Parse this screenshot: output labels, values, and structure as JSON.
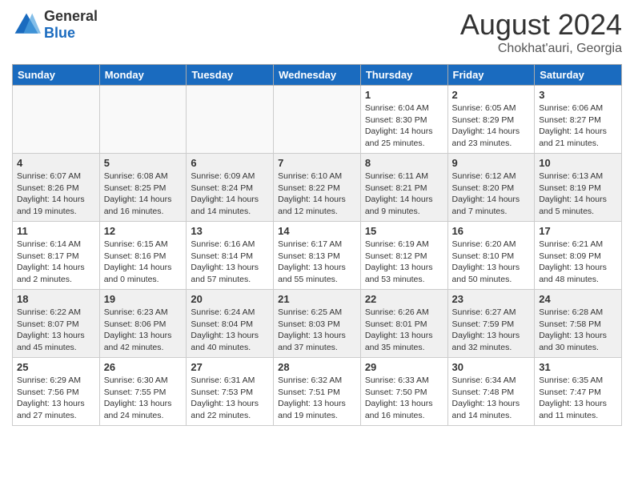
{
  "header": {
    "logo_general": "General",
    "logo_blue": "Blue",
    "month_title": "August 2024",
    "location": "Chokhat'auri, Georgia"
  },
  "days_of_week": [
    "Sunday",
    "Monday",
    "Tuesday",
    "Wednesday",
    "Thursday",
    "Friday",
    "Saturday"
  ],
  "weeks": [
    [
      {
        "day": "",
        "info": ""
      },
      {
        "day": "",
        "info": ""
      },
      {
        "day": "",
        "info": ""
      },
      {
        "day": "",
        "info": ""
      },
      {
        "day": "1",
        "info": "Sunrise: 6:04 AM\nSunset: 8:30 PM\nDaylight: 14 hours and 25 minutes."
      },
      {
        "day": "2",
        "info": "Sunrise: 6:05 AM\nSunset: 8:29 PM\nDaylight: 14 hours and 23 minutes."
      },
      {
        "day": "3",
        "info": "Sunrise: 6:06 AM\nSunset: 8:27 PM\nDaylight: 14 hours and 21 minutes."
      }
    ],
    [
      {
        "day": "4",
        "info": "Sunrise: 6:07 AM\nSunset: 8:26 PM\nDaylight: 14 hours and 19 minutes."
      },
      {
        "day": "5",
        "info": "Sunrise: 6:08 AM\nSunset: 8:25 PM\nDaylight: 14 hours and 16 minutes."
      },
      {
        "day": "6",
        "info": "Sunrise: 6:09 AM\nSunset: 8:24 PM\nDaylight: 14 hours and 14 minutes."
      },
      {
        "day": "7",
        "info": "Sunrise: 6:10 AM\nSunset: 8:22 PM\nDaylight: 14 hours and 12 minutes."
      },
      {
        "day": "8",
        "info": "Sunrise: 6:11 AM\nSunset: 8:21 PM\nDaylight: 14 hours and 9 minutes."
      },
      {
        "day": "9",
        "info": "Sunrise: 6:12 AM\nSunset: 8:20 PM\nDaylight: 14 hours and 7 minutes."
      },
      {
        "day": "10",
        "info": "Sunrise: 6:13 AM\nSunset: 8:19 PM\nDaylight: 14 hours and 5 minutes."
      }
    ],
    [
      {
        "day": "11",
        "info": "Sunrise: 6:14 AM\nSunset: 8:17 PM\nDaylight: 14 hours and 2 minutes."
      },
      {
        "day": "12",
        "info": "Sunrise: 6:15 AM\nSunset: 8:16 PM\nDaylight: 14 hours and 0 minutes."
      },
      {
        "day": "13",
        "info": "Sunrise: 6:16 AM\nSunset: 8:14 PM\nDaylight: 13 hours and 57 minutes."
      },
      {
        "day": "14",
        "info": "Sunrise: 6:17 AM\nSunset: 8:13 PM\nDaylight: 13 hours and 55 minutes."
      },
      {
        "day": "15",
        "info": "Sunrise: 6:19 AM\nSunset: 8:12 PM\nDaylight: 13 hours and 53 minutes."
      },
      {
        "day": "16",
        "info": "Sunrise: 6:20 AM\nSunset: 8:10 PM\nDaylight: 13 hours and 50 minutes."
      },
      {
        "day": "17",
        "info": "Sunrise: 6:21 AM\nSunset: 8:09 PM\nDaylight: 13 hours and 48 minutes."
      }
    ],
    [
      {
        "day": "18",
        "info": "Sunrise: 6:22 AM\nSunset: 8:07 PM\nDaylight: 13 hours and 45 minutes."
      },
      {
        "day": "19",
        "info": "Sunrise: 6:23 AM\nSunset: 8:06 PM\nDaylight: 13 hours and 42 minutes."
      },
      {
        "day": "20",
        "info": "Sunrise: 6:24 AM\nSunset: 8:04 PM\nDaylight: 13 hours and 40 minutes."
      },
      {
        "day": "21",
        "info": "Sunrise: 6:25 AM\nSunset: 8:03 PM\nDaylight: 13 hours and 37 minutes."
      },
      {
        "day": "22",
        "info": "Sunrise: 6:26 AM\nSunset: 8:01 PM\nDaylight: 13 hours and 35 minutes."
      },
      {
        "day": "23",
        "info": "Sunrise: 6:27 AM\nSunset: 7:59 PM\nDaylight: 13 hours and 32 minutes."
      },
      {
        "day": "24",
        "info": "Sunrise: 6:28 AM\nSunset: 7:58 PM\nDaylight: 13 hours and 30 minutes."
      }
    ],
    [
      {
        "day": "25",
        "info": "Sunrise: 6:29 AM\nSunset: 7:56 PM\nDaylight: 13 hours and 27 minutes."
      },
      {
        "day": "26",
        "info": "Sunrise: 6:30 AM\nSunset: 7:55 PM\nDaylight: 13 hours and 24 minutes."
      },
      {
        "day": "27",
        "info": "Sunrise: 6:31 AM\nSunset: 7:53 PM\nDaylight: 13 hours and 22 minutes."
      },
      {
        "day": "28",
        "info": "Sunrise: 6:32 AM\nSunset: 7:51 PM\nDaylight: 13 hours and 19 minutes."
      },
      {
        "day": "29",
        "info": "Sunrise: 6:33 AM\nSunset: 7:50 PM\nDaylight: 13 hours and 16 minutes."
      },
      {
        "day": "30",
        "info": "Sunrise: 6:34 AM\nSunset: 7:48 PM\nDaylight: 13 hours and 14 minutes."
      },
      {
        "day": "31",
        "info": "Sunrise: 6:35 AM\nSunset: 7:47 PM\nDaylight: 13 hours and 11 minutes."
      }
    ]
  ]
}
